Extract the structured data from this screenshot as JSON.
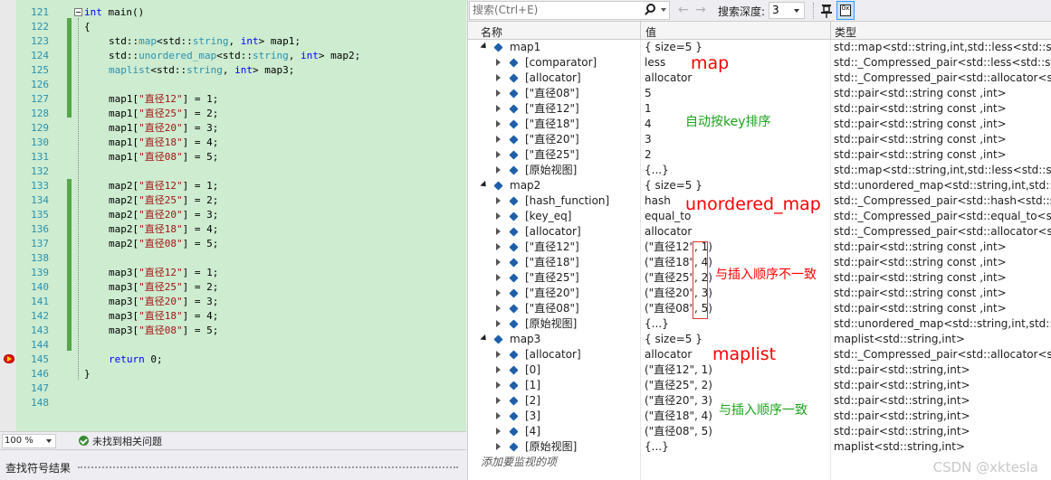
{
  "editor": {
    "line_numbers": [
      "121",
      "122",
      "123",
      "124",
      "125",
      "126",
      "127",
      "128",
      "129",
      "130",
      "131",
      "132",
      "133",
      "134",
      "135",
      "136",
      "137",
      "138",
      "139",
      "140",
      "141",
      "142",
      "143",
      "144",
      "145",
      "146",
      "147",
      "148"
    ],
    "code": {
      "l121_kw": "int",
      "l121_rest": " main()",
      "l122": "{",
      "l123_a": "std::",
      "l123_b": "map",
      "l123_c": "<std::",
      "l123_d": "string",
      "l123_e": ", ",
      "l123_f": "int",
      "l123_g": "> map1;",
      "l124_a": "std::",
      "l124_b": "unordered_map",
      "l124_c": "<std::",
      "l124_d": "string",
      "l124_e": ", ",
      "l124_f": "int",
      "l124_g": "> map2;",
      "l125_a": "maplist",
      "l125_c": "<std::",
      "l125_d": "string",
      "l125_e": ", ",
      "l125_f": "int",
      "l125_g": "> map3;",
      "m1": [
        "map1[",
        "\"直径12\"",
        "] = 1;",
        "map1[",
        "\"直径25\"",
        "] = 2;",
        "map1[",
        "\"直径20\"",
        "] = 3;",
        "map1[",
        "\"直径18\"",
        "] = 4;",
        "map1[",
        "\"直径08\"",
        "] = 5;"
      ],
      "m2": [
        "map2[",
        "\"直径12\"",
        "] = 1;",
        "map2[",
        "\"直径25\"",
        "] = 2;",
        "map2[",
        "\"直径20\"",
        "] = 3;",
        "map2[",
        "\"直径18\"",
        "] = 4;",
        "map2[",
        "\"直径08\"",
        "] = 5;"
      ],
      "m3": [
        "map3[",
        "\"直径12\"",
        "] = 1;",
        "map3[",
        "\"直径25\"",
        "] = 2;",
        "map3[",
        "\"直径20\"",
        "] = 3;",
        "map3[",
        "\"直径18\"",
        "] = 4;",
        "map3[",
        "\"直径08\"",
        "] = 5;"
      ],
      "ret_kw": "return",
      "ret_rest": " 0;",
      "close": "}"
    },
    "zoom": "100 %",
    "issues": "未找到相关问题",
    "find_panel_title": "查找符号结果"
  },
  "watch": {
    "search_placeholder": "搜索(Ctrl+E)",
    "nav_back": "←",
    "nav_forward": "→",
    "depth_label": "搜索深度:",
    "depth_value": "3",
    "hex_icon_text": "0x",
    "headers": {
      "name": "名称",
      "value": "值",
      "type": "类型"
    },
    "rows": [
      {
        "name": "map1",
        "value": "{ size=5 }",
        "type": "std::map<std::string,int,std::less<std::stri..."
      },
      {
        "name": "[comparator]",
        "value": "less",
        "type": "std::_Compressed_pair<std::less<std::stri..."
      },
      {
        "name": "[allocator]",
        "value": "allocator",
        "type": "std::_Compressed_pair<std::allocator<st..."
      },
      {
        "name": "[\"直径08\"]",
        "value": "5",
        "type": "std::pair<std::string const ,int>"
      },
      {
        "name": "[\"直径12\"]",
        "value": "1",
        "type": "std::pair<std::string const ,int>"
      },
      {
        "name": "[\"直径18\"]",
        "value": "4",
        "type": "std::pair<std::string const ,int>"
      },
      {
        "name": "[\"直径20\"]",
        "value": "3",
        "type": "std::pair<std::string const ,int>"
      },
      {
        "name": "[\"直径25\"]",
        "value": "2",
        "type": "std::pair<std::string const ,int>"
      },
      {
        "name": "[原始视图]",
        "value": "{...}",
        "type": "std::map<std::string,int,std::less<std::stri..."
      },
      {
        "name": "map2",
        "value": "{ size=5 }",
        "type": "std::unordered_map<std::string,int,std::h..."
      },
      {
        "name": "[hash_function]",
        "value": "hash",
        "type": "std::_Compressed_pair<std::hash<std::stri..."
      },
      {
        "name": "[key_eq]",
        "value": "equal_to",
        "type": "std::_Compressed_pair<std::equal_to<st..."
      },
      {
        "name": "[allocator]",
        "value": "allocator",
        "type": "std::_Compressed_pair<std::allocator<st..."
      },
      {
        "name": "[\"直径12\"]",
        "value": "(\"直径12\", 1)",
        "type": "std::pair<std::string const ,int>"
      },
      {
        "name": "[\"直径18\"]",
        "value": "(\"直径18\", 4)",
        "type": "std::pair<std::string const ,int>"
      },
      {
        "name": "[\"直径25\"]",
        "value": "(\"直径25\", 2)",
        "type": "std::pair<std::string const ,int>"
      },
      {
        "name": "[\"直径20\"]",
        "value": "(\"直径20\", 3)",
        "type": "std::pair<std::string const ,int>"
      },
      {
        "name": "[\"直径08\"]",
        "value": "(\"直径08\", 5)",
        "type": "std::pair<std::string const ,int>"
      },
      {
        "name": "[原始视图]",
        "value": "{...}",
        "type": "std::unordered_map<std::string,int,std::h..."
      },
      {
        "name": "map3",
        "value": "{ size=5 }",
        "type": "maplist<std::string,int>"
      },
      {
        "name": "[allocator]",
        "value": "allocator",
        "type": "std::_Compressed_pair<std::allocator<st..."
      },
      {
        "name": "[0]",
        "value": "(\"直径12\", 1)",
        "type": "std::pair<std::string,int>"
      },
      {
        "name": "[1]",
        "value": "(\"直径25\", 2)",
        "type": "std::pair<std::string,int>"
      },
      {
        "name": "[2]",
        "value": "(\"直径20\", 3)",
        "type": "std::pair<std::string,int>"
      },
      {
        "name": "[3]",
        "value": "(\"直径18\", 4)",
        "type": "std::pair<std::string,int>"
      },
      {
        "name": "[4]",
        "value": "(\"直径08\", 5)",
        "type": "std::pair<std::string,int>"
      },
      {
        "name": "[原始视图]",
        "value": "{...}",
        "type": "maplist<std::string,int>"
      }
    ],
    "add_watch": "添加要监视的项"
  },
  "annotations": {
    "map": "map",
    "sorted": "自动按key排序",
    "unordered_map": "unordered_map",
    "not_in_order": "与插入顺序不一致",
    "maplist": "maplist",
    "in_order": "与插入顺序一致"
  },
  "colors": {
    "annotation_red": "#ff0000",
    "annotation_green": "#1aa31a",
    "editor_bg": "#cdecd0"
  },
  "watermark": "CSDN @xktesla"
}
